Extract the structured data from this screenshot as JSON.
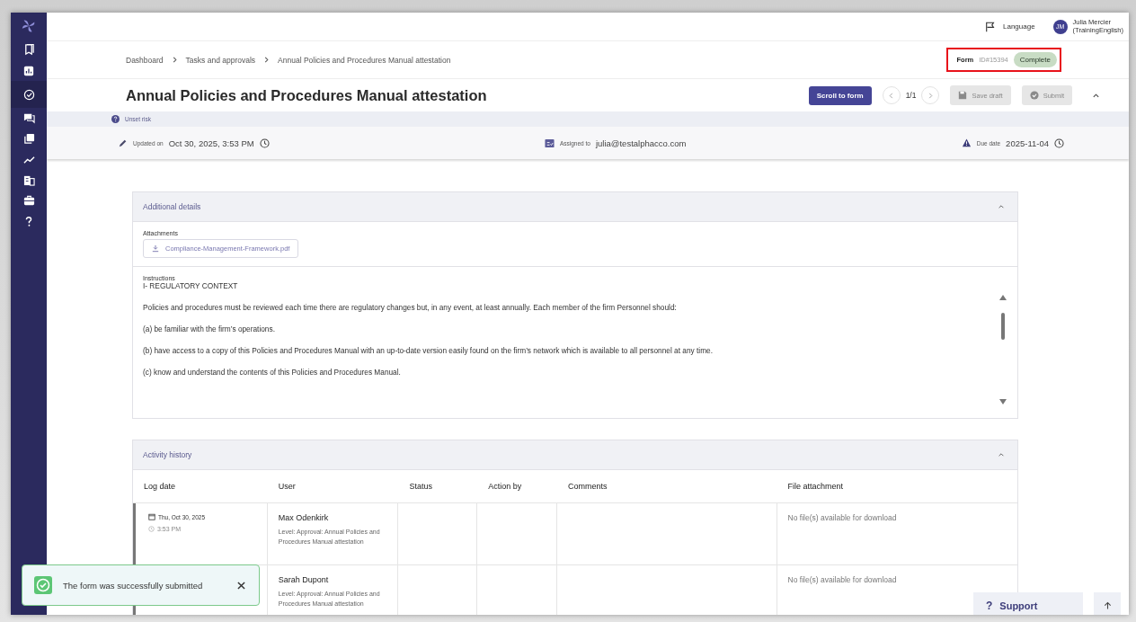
{
  "sidebar": {
    "items": [
      {
        "kind": "documents",
        "selected": false
      },
      {
        "kind": "chart",
        "selected": false
      },
      {
        "kind": "check",
        "selected": true
      },
      {
        "kind": "chat",
        "selected": false
      },
      {
        "kind": "layers",
        "selected": false
      },
      {
        "kind": "trend",
        "selected": false
      },
      {
        "kind": "building",
        "selected": false
      },
      {
        "kind": "toolbox",
        "selected": false
      },
      {
        "kind": "help",
        "selected": false
      }
    ]
  },
  "top_bar": {
    "language": "Language",
    "avatar_initials": "JM",
    "user_name": "Julia Mercier",
    "user_org": "(TrainingEnglish)"
  },
  "breadcrumb": [
    "Dashboard",
    "Tasks and approvals",
    "Annual Policies and Procedures Manual attestation"
  ],
  "form_status": {
    "label": "Form",
    "id": "ID#15394",
    "status": "Complete",
    "highlighted": true
  },
  "title": "Annual Policies and Procedures Manual attestation",
  "actions": {
    "scroll_to_form": "Scroll to form",
    "pager": "1/1",
    "save_draft": {
      "label": "Save draft",
      "disabled": true
    },
    "submit": {
      "label": "Submit",
      "disabled": true
    },
    "expanded": true
  },
  "risk": "Unset risk",
  "info": {
    "updated_label": "Updated on",
    "updated_value": "Oct 30, 2025, 3:53 PM",
    "assigned_label": "Assigned to",
    "assigned_value": "julia@testalphacco.com",
    "due_label": "Due date",
    "due_value": "2025-11-04"
  },
  "additional_details": {
    "title": "Additional details",
    "expanded": true,
    "attachments_label": "Attachments",
    "attachment": "Compliance-Management-Framework.pdf",
    "instructions_label": "Instructions",
    "instructions": [
      "I- REGULATORY CONTEXT",
      "Policies and procedures must be reviewed each time there are regulatory changes but, in any event, at least annually. Each member of the firm Personnel should:",
      "(a) be familiar with the firm’s operations.",
      "(b) have access to a copy of this Policies and Procedures Manual with an up-to-date version easily found on the firm’s network which is available to all personnel at any time.",
      "(c) know and understand the contents of this Policies and Procedures Manual."
    ]
  },
  "activity_history": {
    "title": "Activity history",
    "expanded": true,
    "columns": [
      "Log date",
      "User",
      "Status",
      "Action by",
      "Comments",
      "File attachment"
    ],
    "rows": [
      {
        "date": "Thu, Oct 30, 2025",
        "time": "3:53 PM",
        "user": "Max Odenkirk",
        "level": "Level: Approval: Annual Policies and Procedures Manual attestation",
        "file": "No file(s) available for download"
      },
      {
        "user": "Sarah Dupont",
        "level": "Level: Approval: Annual Policies and Procedures Manual attestation",
        "file": "No file(s) available for download"
      }
    ]
  },
  "toast": {
    "message": "The form was successfully submitted"
  },
  "support": {
    "icon": "?",
    "label": "Support"
  }
}
